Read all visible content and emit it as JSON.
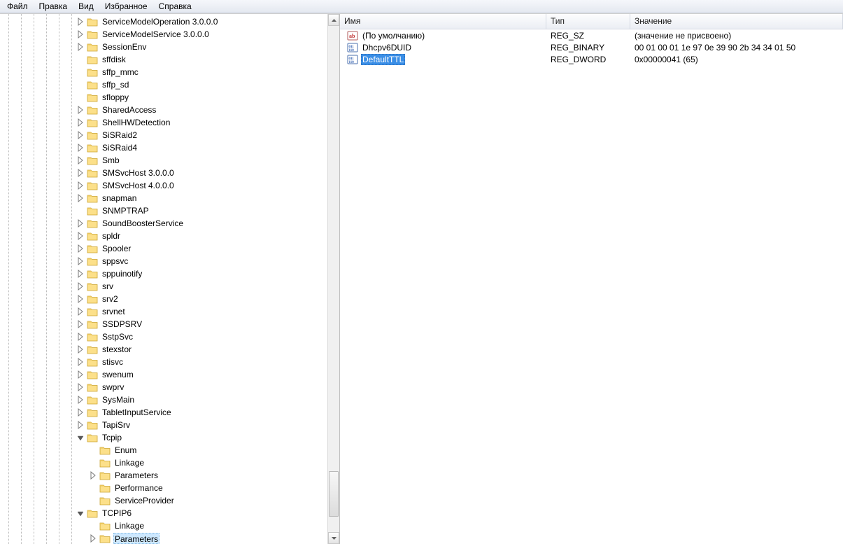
{
  "menu": {
    "file": "Файл",
    "edit": "Правка",
    "view": "Вид",
    "favorites": "Избранное",
    "help": "Справка"
  },
  "columns": {
    "name": "Имя",
    "type": "Тип",
    "value": "Значение"
  },
  "tree": [
    {
      "label": "ServiceModelOperation 3.0.0.0",
      "exp": "closed",
      "depth": 0
    },
    {
      "label": "ServiceModelService 3.0.0.0",
      "exp": "closed",
      "depth": 0
    },
    {
      "label": "SessionEnv",
      "exp": "closed",
      "depth": 0
    },
    {
      "label": "sffdisk",
      "exp": "none",
      "depth": 0
    },
    {
      "label": "sffp_mmc",
      "exp": "none",
      "depth": 0
    },
    {
      "label": "sffp_sd",
      "exp": "none",
      "depth": 0
    },
    {
      "label": "sfloppy",
      "exp": "none",
      "depth": 0
    },
    {
      "label": "SharedAccess",
      "exp": "closed",
      "depth": 0
    },
    {
      "label": "ShellHWDetection",
      "exp": "closed",
      "depth": 0
    },
    {
      "label": "SiSRaid2",
      "exp": "closed",
      "depth": 0
    },
    {
      "label": "SiSRaid4",
      "exp": "closed",
      "depth": 0
    },
    {
      "label": "Smb",
      "exp": "closed",
      "depth": 0
    },
    {
      "label": "SMSvcHost 3.0.0.0",
      "exp": "closed",
      "depth": 0
    },
    {
      "label": "SMSvcHost 4.0.0.0",
      "exp": "closed",
      "depth": 0
    },
    {
      "label": "snapman",
      "exp": "closed",
      "depth": 0
    },
    {
      "label": "SNMPTRAP",
      "exp": "none",
      "depth": 0
    },
    {
      "label": "SoundBoosterService",
      "exp": "closed",
      "depth": 0
    },
    {
      "label": "spldr",
      "exp": "closed",
      "depth": 0
    },
    {
      "label": "Spooler",
      "exp": "closed",
      "depth": 0
    },
    {
      "label": "sppsvc",
      "exp": "closed",
      "depth": 0
    },
    {
      "label": "sppuinotify",
      "exp": "closed",
      "depth": 0
    },
    {
      "label": "srv",
      "exp": "closed",
      "depth": 0
    },
    {
      "label": "srv2",
      "exp": "closed",
      "depth": 0
    },
    {
      "label": "srvnet",
      "exp": "closed",
      "depth": 0
    },
    {
      "label": "SSDPSRV",
      "exp": "closed",
      "depth": 0
    },
    {
      "label": "SstpSvc",
      "exp": "closed",
      "depth": 0
    },
    {
      "label": "stexstor",
      "exp": "closed",
      "depth": 0
    },
    {
      "label": "stisvc",
      "exp": "closed",
      "depth": 0
    },
    {
      "label": "swenum",
      "exp": "closed",
      "depth": 0
    },
    {
      "label": "swprv",
      "exp": "closed",
      "depth": 0
    },
    {
      "label": "SysMain",
      "exp": "closed",
      "depth": 0
    },
    {
      "label": "TabletInputService",
      "exp": "closed",
      "depth": 0
    },
    {
      "label": "TapiSrv",
      "exp": "closed",
      "depth": 0
    },
    {
      "label": "Tcpip",
      "exp": "open",
      "depth": 0
    },
    {
      "label": "Enum",
      "exp": "none",
      "depth": 1
    },
    {
      "label": "Linkage",
      "exp": "none",
      "depth": 1
    },
    {
      "label": "Parameters",
      "exp": "closed",
      "depth": 1
    },
    {
      "label": "Performance",
      "exp": "none",
      "depth": 1
    },
    {
      "label": "ServiceProvider",
      "exp": "none",
      "depth": 1
    },
    {
      "label": "TCPIP6",
      "exp": "open",
      "depth": 0
    },
    {
      "label": "Linkage",
      "exp": "none",
      "depth": 1
    },
    {
      "label": "Parameters",
      "exp": "closed",
      "depth": 1,
      "selected": true
    }
  ],
  "values": [
    {
      "name": "(По умолчанию)",
      "type": "REG_SZ",
      "value": "(значение не присвоено)",
      "icon": "string",
      "selected": false
    },
    {
      "name": "Dhcpv6DUID",
      "type": "REG_BINARY",
      "value": "00 01 00 01 1e 97 0e 39 90 2b 34 34 01 50",
      "icon": "binary",
      "selected": false
    },
    {
      "name": "DefaultTTL",
      "type": "REG_DWORD",
      "value": "0x00000041 (65)",
      "icon": "binary",
      "selected": true
    }
  ],
  "scroll": {
    "thumbTopPct": 88,
    "thumbHeightPct": 9
  }
}
